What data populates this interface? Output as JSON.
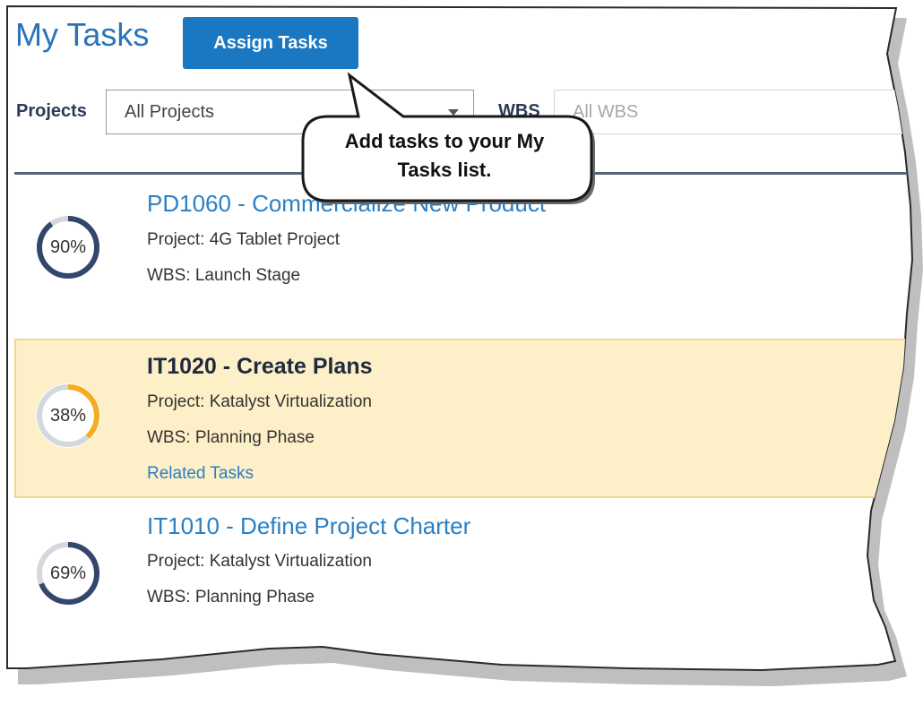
{
  "header": {
    "title": "My Tasks",
    "assign_button": "Assign Tasks"
  },
  "filters": {
    "projects_label": "Projects",
    "projects_value": "All Projects",
    "wbs_label": "WBS",
    "wbs_value": "All WBS"
  },
  "callout": {
    "line1": "Add tasks to your My",
    "line2": "Tasks list."
  },
  "tasks": [
    {
      "percent_label": "90%",
      "percent": 0.9,
      "title": "PD1060 - Commercialize New Product",
      "project": "Project: 4G Tablet Project",
      "wbs": "WBS: Launch Stage",
      "ring_color": "#33466b"
    },
    {
      "percent_label": "38%",
      "percent": 0.38,
      "title": "IT1020 - Create Plans",
      "project": "Project: Katalyst Virtualization",
      "wbs": "WBS: Planning Phase",
      "related": "Related Tasks",
      "ring_color": "#f4ad22",
      "selected": true
    },
    {
      "percent_label": "69%",
      "percent": 0.69,
      "title": "IT1010 - Define Project Charter",
      "project": "Project: Katalyst Virtualization",
      "wbs": "WBS: Planning Phase",
      "ring_color": "#33466b"
    }
  ],
  "colors": {
    "accent": "#1a78c2",
    "title_blue": "#2a73b8",
    "ring_track": "#d4d8dd",
    "selected_bg": "#fdefc7"
  }
}
